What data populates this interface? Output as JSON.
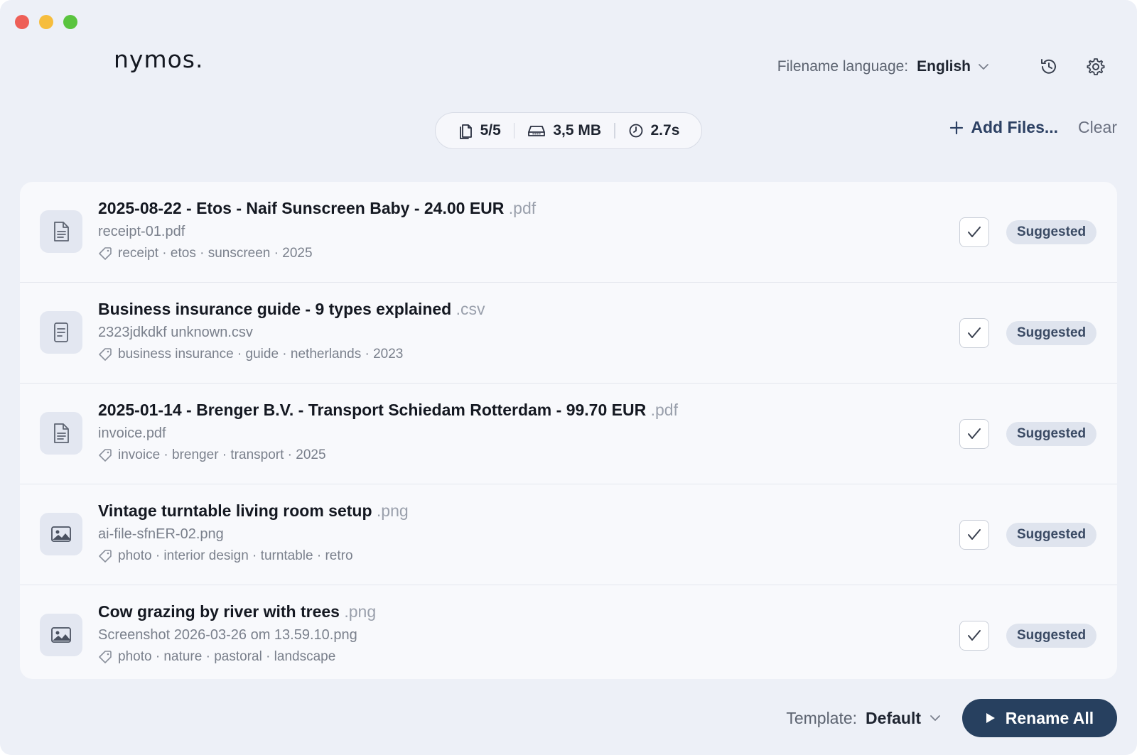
{
  "app": {
    "logo": "nymos."
  },
  "header": {
    "language_label": "Filename language:",
    "language_value": "English",
    "history_icon": "history-icon",
    "settings_icon": "gear-icon"
  },
  "stats": {
    "files": "5/5",
    "size": "3,5 MB",
    "time": "2.7s"
  },
  "actions": {
    "add_files": "Add Files...",
    "clear": "Clear"
  },
  "files": [
    {
      "name": "2025-08-22 - Etos - Naif Sunscreen Baby - 24.00 EUR",
      "ext": ".pdf",
      "original": "receipt-01.pdf",
      "tags": "receipt · etos · sunscreen · 2025",
      "icon": "document-icon",
      "status": "Suggested",
      "checked": true
    },
    {
      "name": "Business insurance guide - 9 types explained",
      "ext": ".csv",
      "original": "2323jdkdkf unknown.csv",
      "tags": "business insurance · guide · netherlands · 2023",
      "icon": "spreadsheet-icon",
      "status": "Suggested",
      "checked": true
    },
    {
      "name": "2025-01-14 - Brenger B.V. - Transport Schiedam Rotterdam - 99.70 EUR",
      "ext": ".pdf",
      "original": "invoice.pdf",
      "tags": "invoice · brenger · transport · 2025",
      "icon": "document-icon",
      "status": "Suggested",
      "checked": true
    },
    {
      "name": "Vintage turntable living room setup",
      "ext": ".png",
      "original": "ai-file-sfnER-02.png",
      "tags": "photo · interior design · turntable · retro",
      "icon": "image-icon",
      "status": "Suggested",
      "checked": true
    },
    {
      "name": "Cow grazing by river with trees",
      "ext": ".png",
      "original": "Screenshot 2026-03-26 om 13.59.10.png",
      "tags": "photo · nature · pastoral · landscape",
      "icon": "image-icon",
      "status": "Suggested",
      "checked": true
    }
  ],
  "footer": {
    "template_label": "Template:",
    "template_value": "Default",
    "rename_button": "Rename All"
  }
}
